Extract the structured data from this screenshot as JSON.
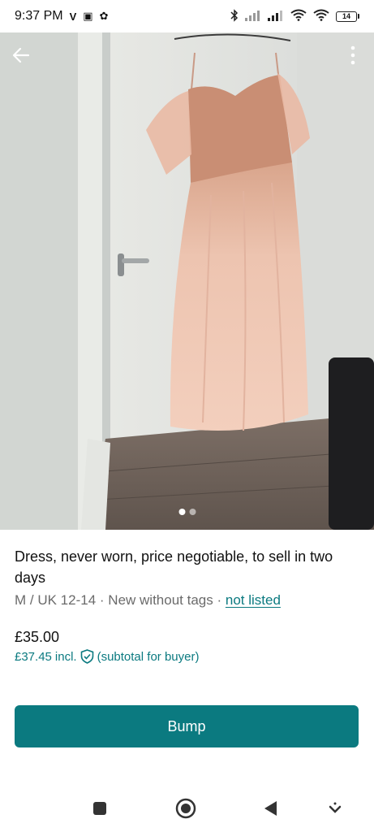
{
  "status_bar": {
    "time": "9:37 PM",
    "left_glyphs": [
      "V",
      "▣",
      "✿"
    ],
    "battery": "14"
  },
  "photo": {
    "alt_icons": [
      "back-arrow-icon",
      "more-vertical-icon"
    ],
    "current_index": 0,
    "count": 2
  },
  "listing": {
    "title": "Dress, never worn, price negotiable, to sell in two days",
    "size": "M / UK 12-14",
    "condition": "New without tags",
    "separator": "·",
    "status_link": "not listed",
    "price": "£35.00",
    "price_incl": "£37.45",
    "incl_label": "incl.",
    "subtotal_label": "(subtotal for buyer)"
  },
  "actions": {
    "bump_label": "Bump"
  },
  "colors": {
    "accent": "#0b7a80",
    "muted_text": "#6b6b6b"
  }
}
